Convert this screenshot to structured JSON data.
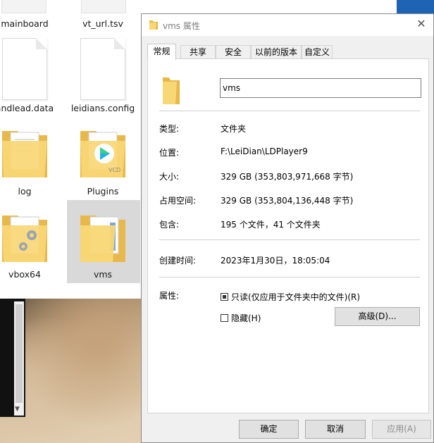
{
  "explorer": {
    "items": [
      {
        "name": "mainboard"
      },
      {
        "name": "vt_url.tsv"
      },
      {
        "name": "andlead.data"
      },
      {
        "name": "leidians.config"
      },
      {
        "name": "log"
      },
      {
        "name": "Plugins"
      },
      {
        "name": "vbox64"
      },
      {
        "name": "vms"
      }
    ],
    "plugins_badge": "VCD"
  },
  "dialog": {
    "title": "vms 属性",
    "close_glyph": "✕",
    "tabs": [
      {
        "label": "常规",
        "active": true
      },
      {
        "label": "共享"
      },
      {
        "label": "安全"
      },
      {
        "label": "以前的版本"
      },
      {
        "label": "自定义"
      }
    ],
    "name_value": "vms",
    "properties": [
      {
        "label": "类型:",
        "value": "文件夹"
      },
      {
        "label": "位置:",
        "value": "F:\\LeiDian\\LDPlayer9"
      },
      {
        "label": "大小:",
        "value": "329 GB (353,803,971,668 字节)"
      },
      {
        "label": "占用空间:",
        "value": "329 GB (353,804,136,448 字节)"
      },
      {
        "label": "包含:",
        "value": "195 个文件，41 个文件夹"
      }
    ],
    "created": {
      "label": "创建时间:",
      "value": "2023年1月30日，18:05:04"
    },
    "attributes": {
      "label": "属性:",
      "readonly": {
        "label": "只读(仅应用于文件夹中的文件)(R)",
        "state": "indeterminate"
      },
      "hidden": {
        "label": "隐藏(H)",
        "state": "unchecked"
      },
      "advanced_button": "高级(D)..."
    },
    "buttons": {
      "ok": "确定",
      "cancel": "取消",
      "apply": "应用(A)"
    }
  },
  "colors": {
    "folder_yellow": "#f8d775",
    "folder_dark": "#e8b94a",
    "selection": "#d9d9d9",
    "dialog_bg": "#f0f0f0"
  }
}
